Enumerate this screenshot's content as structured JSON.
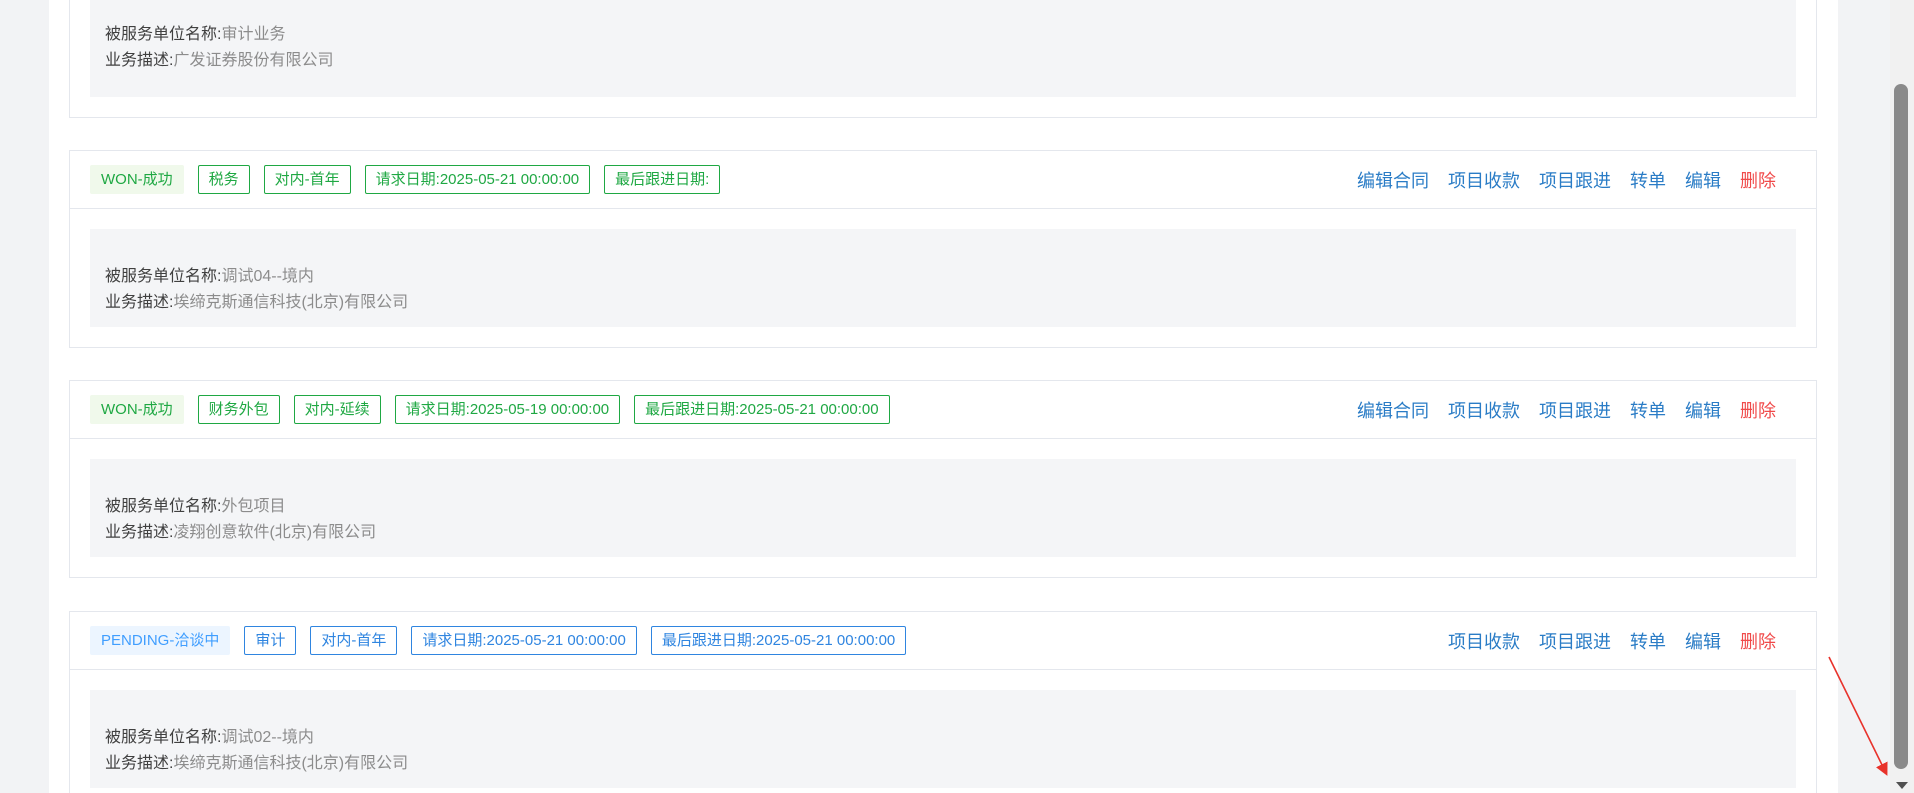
{
  "cards": [
    {
      "service_unit_label": "被服务单位名称:",
      "service_unit_value": "审计业务",
      "desc_label": "业务描述:",
      "desc_value": "广发证券股份有限公司"
    },
    {
      "status": "WON-成功",
      "tags": [
        "税务",
        "对内-首年",
        "请求日期:2025-05-21 00:00:00",
        "最后跟进日期:"
      ],
      "actions": [
        "编辑合同",
        "项目收款",
        "项目跟进",
        "转单",
        "编辑"
      ],
      "delete_label": "删除",
      "service_unit_label": "被服务单位名称:",
      "service_unit_value": "调试04--境内",
      "desc_label": "业务描述:",
      "desc_value": "埃缔克斯通信科技(北京)有限公司"
    },
    {
      "status": "WON-成功",
      "tags": [
        "财务外包",
        "对内-延续",
        "请求日期:2025-05-19 00:00:00",
        "最后跟进日期:2025-05-21 00:00:00"
      ],
      "actions": [
        "编辑合同",
        "项目收款",
        "项目跟进",
        "转单",
        "编辑"
      ],
      "delete_label": "删除",
      "service_unit_label": "被服务单位名称:",
      "service_unit_value": "外包项目",
      "desc_label": "业务描述:",
      "desc_value": "凌翔创意软件(北京)有限公司"
    },
    {
      "status": "PENDING-洽谈中",
      "tags": [
        "审计",
        "对内-首年",
        "请求日期:2025-05-21 00:00:00",
        "最后跟进日期:2025-05-21 00:00:00"
      ],
      "actions": [
        "项目收款",
        "项目跟进",
        "转单",
        "编辑"
      ],
      "delete_label": "删除",
      "service_unit_label": "被服务单位名称:",
      "service_unit_value": "调试02--境内",
      "desc_label": "业务描述:",
      "desc_value": "埃缔克斯通信科技(北京)有限公司"
    }
  ],
  "colors": {
    "won": "#1fa843",
    "pending": "#409eff",
    "link": "#2a7cc6",
    "danger": "#f04a4a",
    "annotation": "#e8322b"
  }
}
